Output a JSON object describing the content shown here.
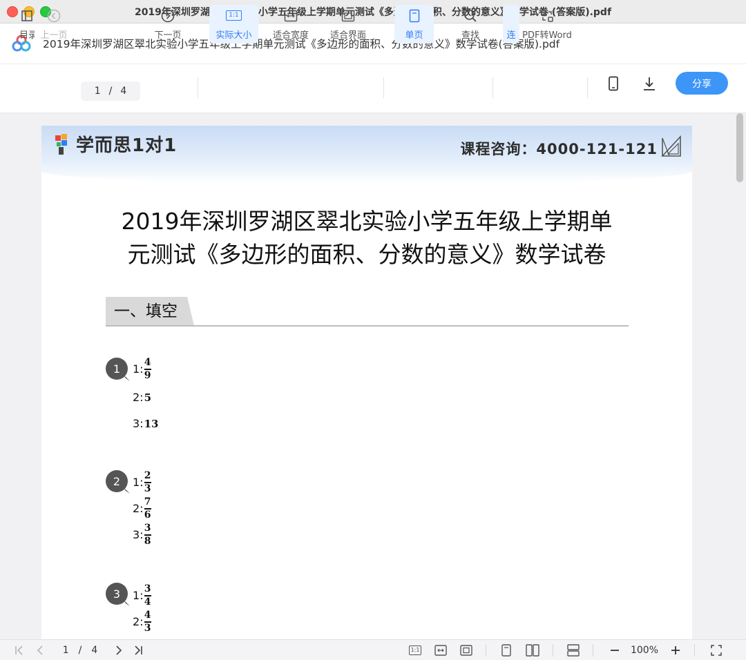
{
  "window": {
    "title": "2019年深圳罗湖区翠北实验小学五年级上学期单元测试《多边形的面积、分数的意义》数学试卷 (答案版).pdf"
  },
  "header": {
    "doc_title": "2019年深圳罗湖区翠北实验小学五年级上学期单元测试《多边形的面积、分数的意义》数学试卷(答案版).pdf"
  },
  "toolbar": {
    "toc_label": "目录",
    "prev_label": "上一页",
    "page_current": "1",
    "page_sep": "/",
    "page_total": "4",
    "next_label": "下一页",
    "actual_size_label": "实际大小",
    "actual_size_icon_text": "1:1",
    "fit_width_label": "适合宽度",
    "fit_page_label": "适合界面",
    "single_page_label": "单页",
    "find_label": "查找",
    "continuous_label": "连",
    "pdf2word_label": "PDF转Word",
    "share_label": "分享"
  },
  "page": {
    "brand": "学而思1对1",
    "contact": "课程咨询：4000-121-121",
    "title_line1": "2019年深圳罗湖区翠北实验小学五年级上学期单",
    "title_line2": "元测试《多边形的面积、分数的意义》数学试卷",
    "section": "一、填空",
    "questions": [
      {
        "no": "1",
        "answers": [
          {
            "n": "1:",
            "num": "4",
            "den": "9"
          },
          {
            "n": "2:",
            "val": "5"
          },
          {
            "n": "3:",
            "val": "13"
          }
        ]
      },
      {
        "no": "2",
        "answers": [
          {
            "n": "1:",
            "num": "2",
            "den": "3"
          },
          {
            "n": "2:",
            "num": "7",
            "den": "6"
          },
          {
            "n": "3:",
            "num": "3",
            "den": "8"
          }
        ]
      },
      {
        "no": "3",
        "answers": [
          {
            "n": "1:",
            "num": "3",
            "den": "4"
          },
          {
            "n": "2:",
            "num": "4",
            "den": "3"
          }
        ]
      }
    ]
  },
  "bottombar": {
    "page_current": "1",
    "page_sep": "/",
    "page_total": "4",
    "actual_size_icon_text": "1:1",
    "zoom": "100%"
  },
  "colors": {
    "accent": "#3d96f7",
    "active_bg": "#e9f2ff"
  }
}
